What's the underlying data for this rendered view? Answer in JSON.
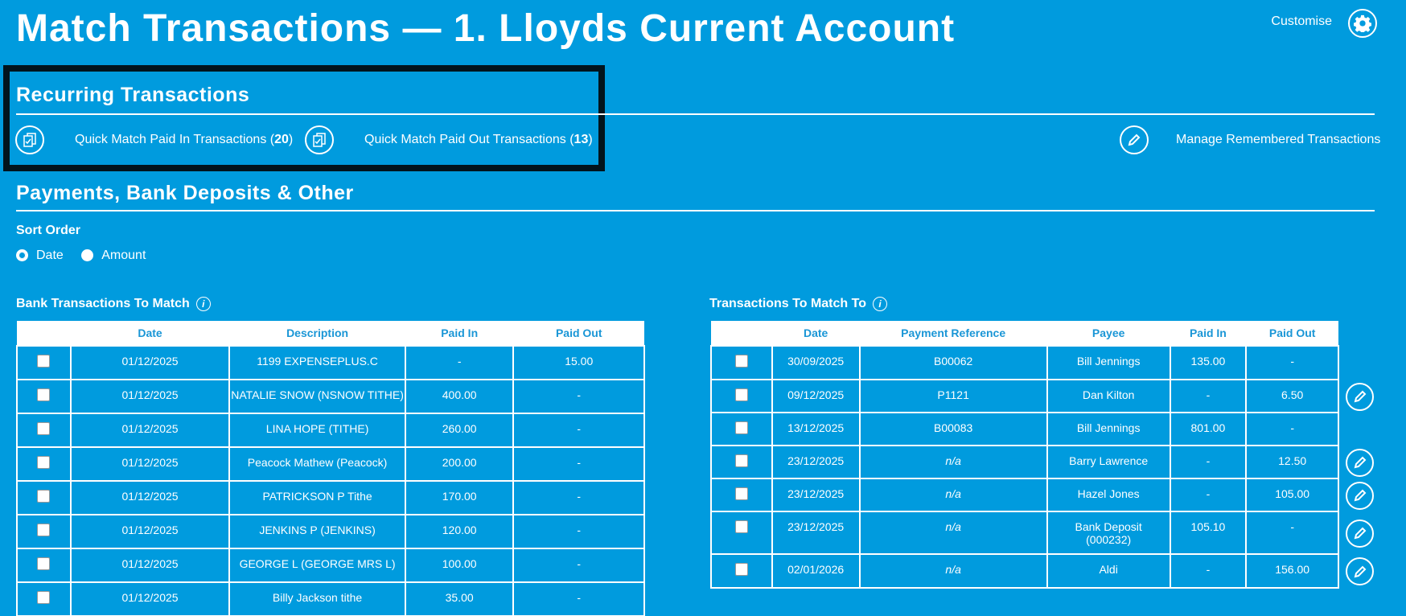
{
  "header": {
    "title": "Match Transactions — 1. Lloyds Current Account",
    "customise_label": "Customise"
  },
  "recurring": {
    "heading": "Recurring Transactions",
    "quick_in_label": "Quick Match Paid In Transactions (",
    "quick_in_count": "20",
    "quick_out_label": "Quick Match Paid Out Transactions (",
    "quick_out_count": "13",
    "close_paren": ")",
    "manage_label": "Manage Remembered Transactions"
  },
  "payments": {
    "heading": "Payments, Bank Deposits & Other",
    "sort_label": "Sort Order",
    "sort_options": [
      "Date",
      "Amount"
    ],
    "sort_selected": "Date"
  },
  "bank_table": {
    "title": "Bank Transactions To Match",
    "headers": [
      "Date",
      "Description",
      "Paid In",
      "Paid Out"
    ],
    "rows": [
      [
        "01/12/2025",
        "1199 EXPENSEPLUS.C",
        "-",
        "15.00"
      ],
      [
        "01/12/2025",
        "NATALIE SNOW (NSNOW TITHE)",
        "400.00",
        "-"
      ],
      [
        "01/12/2025",
        "LINA HOPE (TITHE)",
        "260.00",
        "-"
      ],
      [
        "01/12/2025",
        "Peacock Mathew (Peacock)",
        "200.00",
        "-"
      ],
      [
        "01/12/2025",
        "PATRICKSON P Tithe",
        "170.00",
        "-"
      ],
      [
        "01/12/2025",
        "JENKINS P (JENKINS)",
        "120.00",
        "-"
      ],
      [
        "01/12/2025",
        "GEORGE L (GEORGE MRS L)",
        "100.00",
        "-"
      ],
      [
        "01/12/2025",
        "Billy Jackson tithe",
        "35.00",
        "-"
      ]
    ]
  },
  "match_table": {
    "title": "Transactions To Match To",
    "headers": [
      "Date",
      "Payment Reference",
      "Payee",
      "Paid In",
      "Paid Out"
    ],
    "rows": [
      [
        "30/09/2025",
        "B00062",
        "Bill Jennings",
        "135.00",
        "-"
      ],
      [
        "09/12/2025",
        "P1121",
        "Dan Kilton",
        "-",
        "6.50"
      ],
      [
        "13/12/2025",
        "B00083",
        "Bill Jennings",
        "801.00",
        "-"
      ],
      [
        "23/12/2025",
        "n/a",
        "Barry Lawrence",
        "-",
        "12.50"
      ],
      [
        "23/12/2025",
        "n/a",
        "Hazel Jones",
        "-",
        "105.00"
      ],
      [
        "23/12/2025",
        "n/a",
        "Bank Deposit (000232)",
        "105.10",
        "-"
      ],
      [
        "02/01/2026",
        "n/a",
        "Aldi",
        "-",
        "156.00"
      ]
    ],
    "editable_rows": [
      false,
      true,
      false,
      true,
      true,
      true,
      true
    ]
  }
}
